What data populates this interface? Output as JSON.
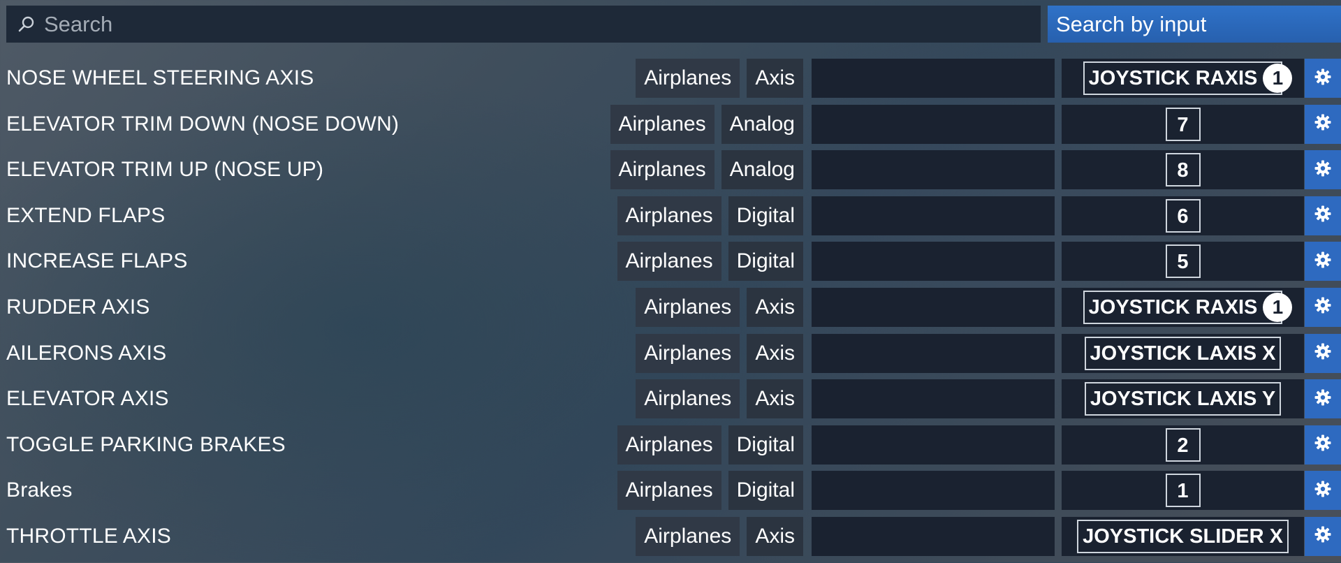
{
  "search": {
    "placeholder": "Search",
    "search_by_input_label": "Search by input"
  },
  "colors": {
    "accent": "#2f72c8",
    "slot_bg": "#1a2230",
    "tag_bg": "#2b3440"
  },
  "icons": {
    "search": "search-icon",
    "settings": "gear-icon"
  },
  "rows": [
    {
      "name": "NOSE WHEEL STEERING AXIS",
      "category": "Airplanes",
      "type": "Axis",
      "binding": "JOYSTICK RAXIS",
      "badge": "1"
    },
    {
      "name": "ELEVATOR TRIM DOWN (NOSE DOWN)",
      "category": "Airplanes",
      "type": "Analog",
      "binding": "7",
      "badge": ""
    },
    {
      "name": "ELEVATOR TRIM UP (NOSE UP)",
      "category": "Airplanes",
      "type": "Analog",
      "binding": "8",
      "badge": ""
    },
    {
      "name": "EXTEND FLAPS",
      "category": "Airplanes",
      "type": "Digital",
      "binding": "6",
      "badge": ""
    },
    {
      "name": "INCREASE FLAPS",
      "category": "Airplanes",
      "type": "Digital",
      "binding": "5",
      "badge": ""
    },
    {
      "name": "RUDDER AXIS",
      "category": "Airplanes",
      "type": "Axis",
      "binding": "JOYSTICK RAXIS",
      "badge": "1"
    },
    {
      "name": "AILERONS AXIS",
      "category": "Airplanes",
      "type": "Axis",
      "binding": "JOYSTICK LAXIS X",
      "badge": ""
    },
    {
      "name": "ELEVATOR AXIS",
      "category": "Airplanes",
      "type": "Axis",
      "binding": "JOYSTICK LAXIS Y",
      "badge": ""
    },
    {
      "name": "TOGGLE PARKING BRAKES",
      "category": "Airplanes",
      "type": "Digital",
      "binding": "2",
      "badge": ""
    },
    {
      "name": "Brakes",
      "category": "Airplanes",
      "type": "Digital",
      "binding": "1",
      "badge": ""
    },
    {
      "name": "THROTTLE AXIS",
      "category": "Airplanes",
      "type": "Axis",
      "binding": "JOYSTICK SLIDER X",
      "badge": ""
    }
  ]
}
